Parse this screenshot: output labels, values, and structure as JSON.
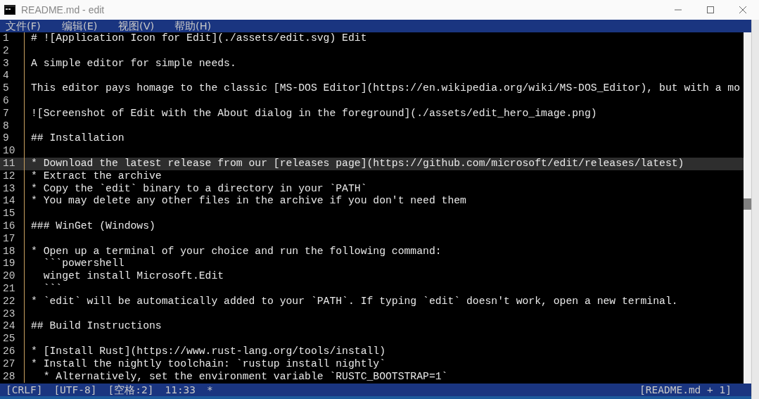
{
  "window": {
    "title": "README.md - edit"
  },
  "menus": [
    {
      "label": "文件(F)"
    },
    {
      "label": "编辑(E)"
    },
    {
      "label": "视图(V)"
    },
    {
      "label": "帮助(H)"
    }
  ],
  "editor": {
    "lines": [
      {
        "number": "1",
        "text": "# ![Application Icon for Edit](./assets/edit.svg) Edit",
        "current": false
      },
      {
        "number": "2",
        "current": false
      },
      {
        "number": "3",
        "text": "A simple editor for simple needs.",
        "current": false
      },
      {
        "number": "4",
        "current": false
      },
      {
        "number": "5",
        "text": "This editor pays homage to the classic [MS-DOS Editor](https://en.wikipedia.org/wiki/MS-DOS_Editor), but with a mo",
        "current": false
      },
      {
        "number": "6",
        "current": false
      },
      {
        "number": "7",
        "text": "![Screenshot of Edit with the About dialog in the foreground](./assets/edit_hero_image.png)",
        "current": false
      },
      {
        "number": "8",
        "current": false
      },
      {
        "number": "9",
        "text": "## Installation",
        "current": false
      },
      {
        "number": "10",
        "current": false
      },
      {
        "number": "11",
        "text": "* Download the latest release from our [releases page](https://github.com/microsoft/edit/releases/latest)",
        "current": true
      },
      {
        "number": "12",
        "text": "* Extract the archive",
        "current": false
      },
      {
        "number": "13",
        "text": "* Copy the `edit` binary to a directory in your `PATH`",
        "current": false
      },
      {
        "number": "14",
        "text": "* You may delete any other files in the archive if you don't need them",
        "current": false
      },
      {
        "number": "15",
        "current": false
      },
      {
        "number": "16",
        "text": "### WinGet (Windows)",
        "current": false
      },
      {
        "number": "17",
        "current": false
      },
      {
        "number": "18",
        "text": "* Open up a terminal of your choice and run the following command:",
        "current": false
      },
      {
        "number": "19",
        "text": "  ```powershell",
        "current": false
      },
      {
        "number": "20",
        "text": "  winget install Microsoft.Edit",
        "current": false
      },
      {
        "number": "21",
        "text": "  ```",
        "current": false
      },
      {
        "number": "22",
        "text": "* `edit` will be automatically added to your `PATH`. If typing `edit` doesn't work, open a new terminal.",
        "current": false
      },
      {
        "number": "23",
        "current": false
      },
      {
        "number": "24",
        "text": "## Build Instructions",
        "current": false
      },
      {
        "number": "25",
        "current": false
      },
      {
        "number": "26",
        "text": "* [Install Rust](https://www.rust-lang.org/tools/install)",
        "current": false
      },
      {
        "number": "27",
        "text": "* Install the nightly toolchain: `rustup install nightly`",
        "current": false
      },
      {
        "number": "28",
        "text": "  * Alternatively, set the environment variable `RUSTC_BOOTSTRAP=1`",
        "current": false
      }
    ]
  },
  "status_bar": {
    "left": [
      "[CRLF]",
      "[UTF-8]",
      "[空格:2]",
      "11:33",
      "*"
    ],
    "right": "[README.md + 1]"
  }
}
